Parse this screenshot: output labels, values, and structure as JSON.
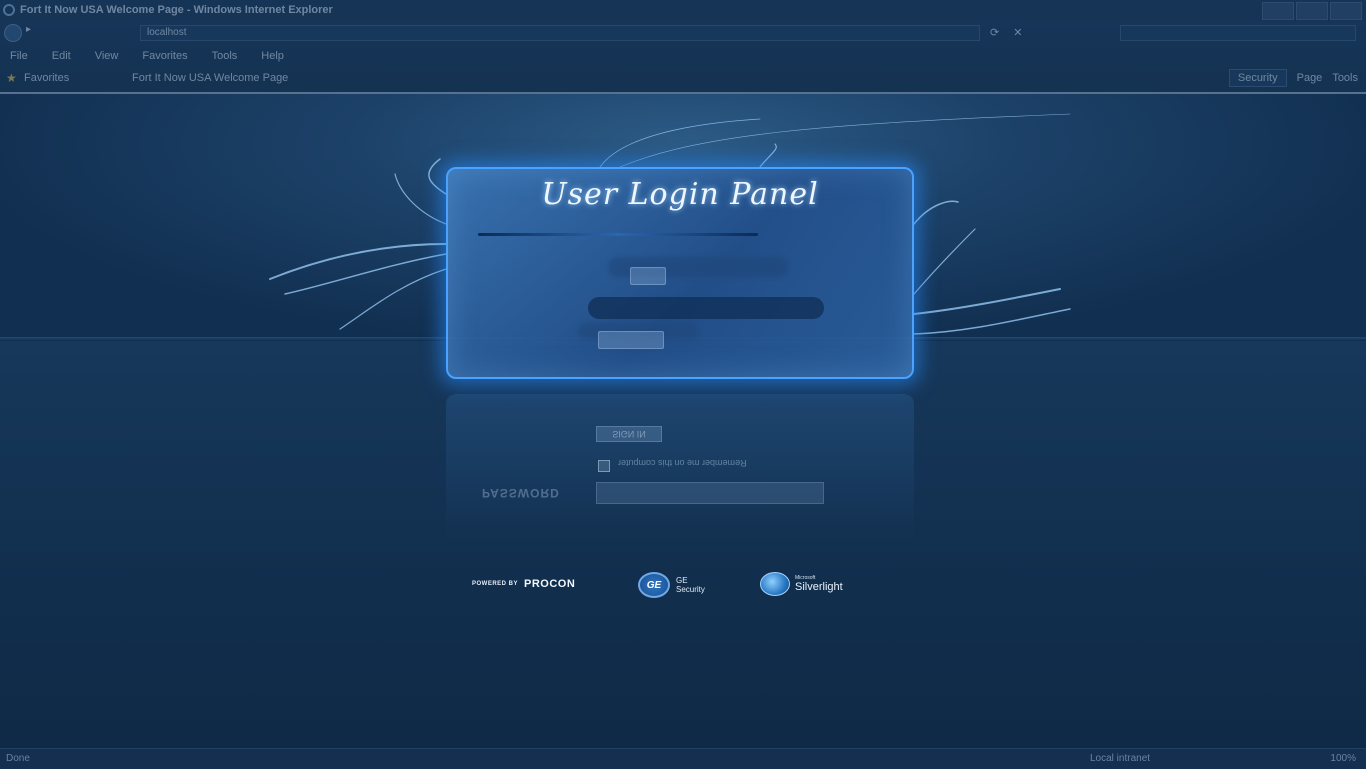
{
  "browser": {
    "window_title": "Fort It Now USA Welcome Page - Windows Internet Explorer",
    "address": "localhost",
    "menu": [
      "File",
      "Edit",
      "View",
      "Favorites",
      "Tools",
      "Help"
    ],
    "favorites_label": "Favorites",
    "tab_title": "Fort It Now USA Welcome Page",
    "tools": {
      "security": "Security",
      "page": "Page",
      "tools": "Tools"
    }
  },
  "login": {
    "title": "User Login Panel",
    "signin_label": "",
    "reflection": {
      "signin_label": "SIGN IN",
      "remember_text": "Remember me on this computer",
      "password_label": "PASSWORD"
    }
  },
  "logos": {
    "powered_by": "POWERED BY",
    "procon": "PROCON",
    "ge_mark": "GE",
    "ge_line1": "GE",
    "ge_line2": "Security",
    "silverlight_pre": "Microsoft",
    "silverlight": "Silverlight"
  },
  "status": {
    "left": "Done",
    "zone": "Local intranet",
    "zoom": "100%"
  },
  "colors": {
    "panel_glow": "#4aa3ff",
    "background": "#143255"
  },
  "icons": {
    "ie": "ie-icon",
    "back": "back-arrow-icon",
    "star": "star-icon"
  }
}
